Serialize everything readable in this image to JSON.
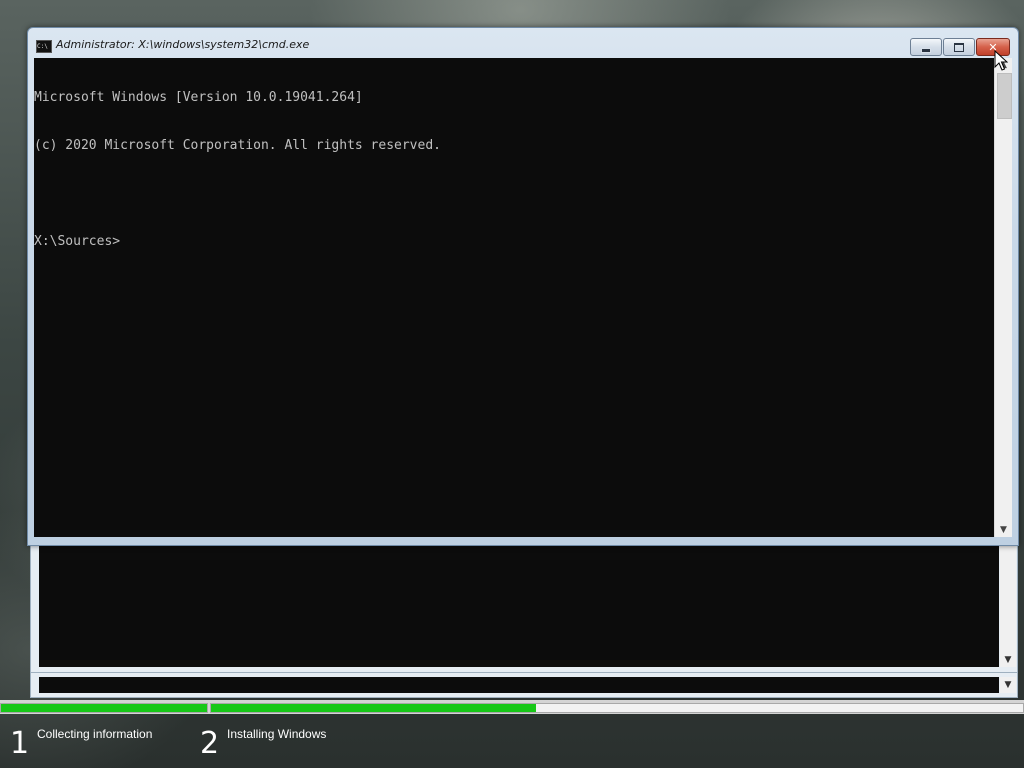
{
  "cmd_window": {
    "title": "Administrator: X:\\windows\\system32\\cmd.exe",
    "icon": "cmd-icon",
    "icon_text": "C:\\",
    "buttons": {
      "minimize_icon": "minimize-icon",
      "maximize_icon": "maximize-icon",
      "close_icon": "close-icon",
      "close_glyph": "✕"
    },
    "console_lines": [
      "Microsoft Windows [Version 10.0.19041.264]",
      "(c) 2020 Microsoft Corporation. All rights reserved.",
      "",
      "X:\\Sources>"
    ]
  },
  "setup": {
    "progress": {
      "segments": [
        {
          "fill": 1.0
        },
        {
          "fill": 0.4
        }
      ]
    },
    "steps": [
      {
        "number": "1",
        "label": "Collecting information"
      },
      {
        "number": "2",
        "label": "Installing Windows"
      }
    ]
  },
  "colors": {
    "console_bg": "#0c0c0c",
    "console_text": "#c0c0c0",
    "progress_fill": "#17c817",
    "close_button": "#c0402a"
  }
}
